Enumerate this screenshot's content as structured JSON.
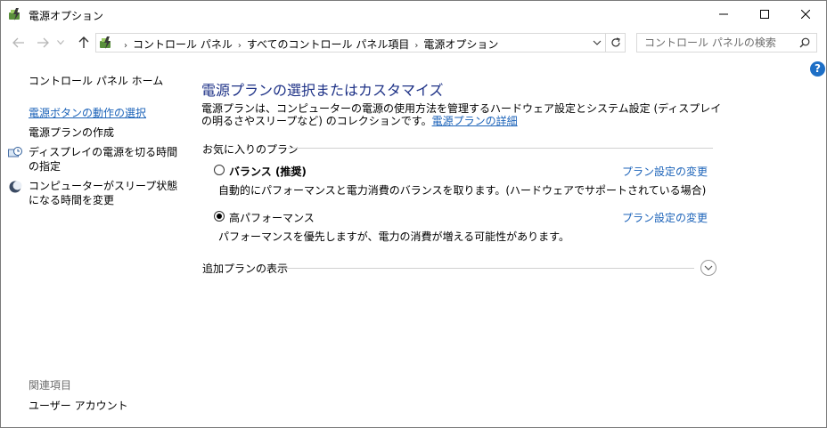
{
  "window": {
    "title": "電源オプション",
    "minimize_label": "最小化",
    "maximize_label": "最大化",
    "close_label": "閉じる"
  },
  "address_bar": {
    "breadcrumbs": [
      "コントロール パネル",
      "すべてのコントロール パネル項目",
      "電源オプション"
    ],
    "search_placeholder": "コントロール パネルの検索"
  },
  "sidebar": {
    "home": "コントロール パネル ホーム",
    "links": [
      {
        "label": "電源ボタンの動作の選択",
        "active": true
      },
      {
        "label": "電源プランの作成",
        "active": false
      }
    ],
    "icon_links": [
      {
        "label": "ディスプレイの電源を切る時間の指定",
        "icon": "display-clock-icon"
      },
      {
        "label": "コンピューターがスリープ状態になる時間を変更",
        "icon": "moon-icon"
      }
    ],
    "related_heading": "関連項目",
    "related_link": "ユーザー アカウント"
  },
  "main": {
    "heading": "電源プランの選択またはカスタマイズ",
    "description": "電源プランは、コンピューターの電源の使用方法を管理するハードウェア設定とシステム設定 (ディスプレイの明るさやスリープなど) のコレクションです。",
    "description_link": "電源プランの詳細",
    "favorites_label": "お気に入りのプラン",
    "plans": [
      {
        "name": "バランス (推奨)",
        "selected": false,
        "desc": "自動的にパフォーマンスと電力消費のバランスを取ります。(ハードウェアでサポートされている場合)",
        "link": "プラン設定の変更"
      },
      {
        "name": "高パフォーマンス",
        "selected": true,
        "desc": "パフォーマンスを優先しますが、電力の消費が増える可能性があります。",
        "link": "プラン設定の変更"
      }
    ],
    "more_plans_label": "追加プランの表示"
  },
  "colors": {
    "heading": "#1e3287",
    "link": "#1c63b9",
    "help_badge": "#1e6fc6"
  }
}
